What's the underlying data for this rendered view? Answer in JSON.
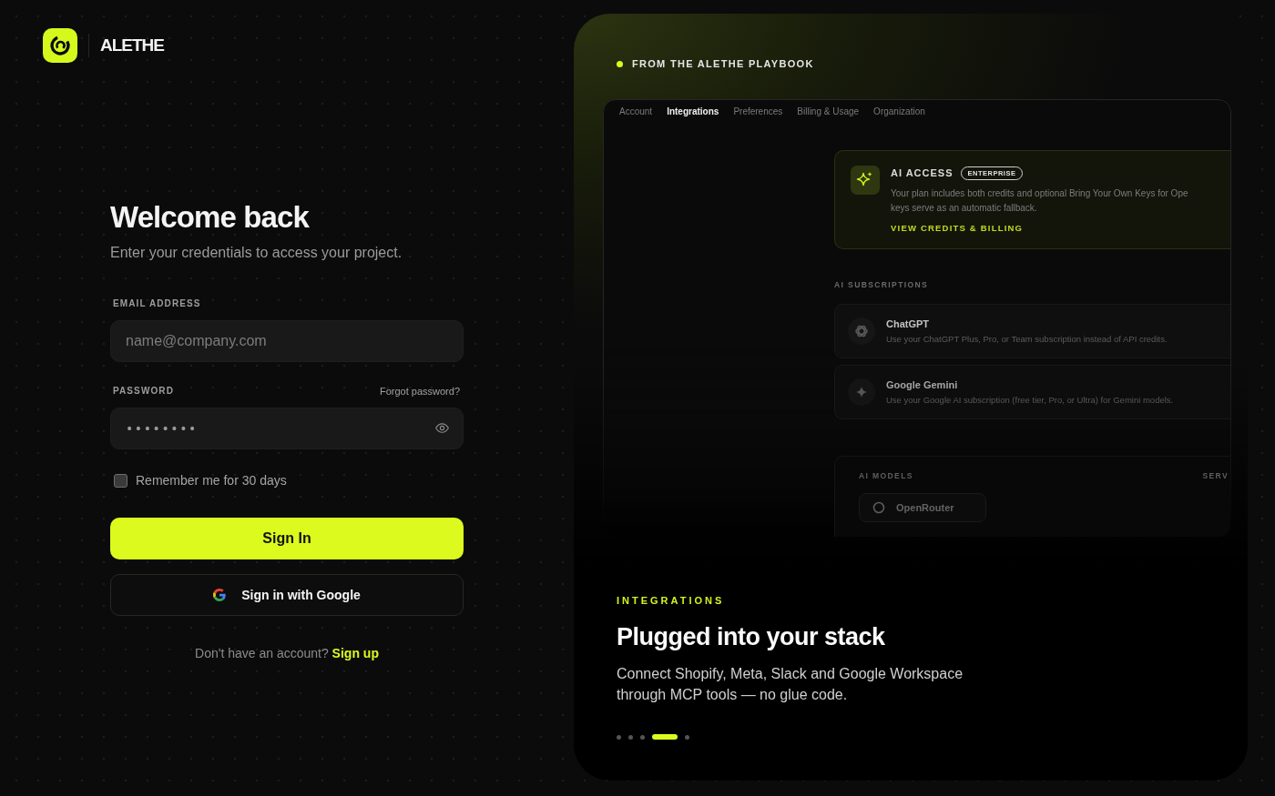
{
  "brand": {
    "name": "ALETHE"
  },
  "login": {
    "title": "Welcome back",
    "subtitle": "Enter your credentials to access your project.",
    "email": {
      "label": "EMAIL ADDRESS",
      "placeholder": "name@company.com"
    },
    "password": {
      "label": "PASSWORD",
      "link": "Forgot password?",
      "value": "••••••••"
    },
    "remember": {
      "label": "Remember me for 30 days",
      "checked": false
    },
    "sign_in_button": "Sign In",
    "google_button": "Sign in with Google",
    "signup": {
      "text": "Don't have an account?",
      "link": "Sign up"
    }
  },
  "showcase": {
    "eyebrow": "FROM THE ALETHE PLAYBOOK",
    "preview": {
      "tabs": [
        {
          "label": "Account",
          "selected": false
        },
        {
          "label": "Integrations",
          "selected": true
        },
        {
          "label": "Preferences",
          "selected": false
        },
        {
          "label": "Billing & Usage",
          "selected": false
        },
        {
          "label": "Organization",
          "selected": false
        }
      ],
      "ai_access": {
        "title": "AI ACCESS",
        "badge": "ENTERPRISE",
        "lines": [
          "Your plan includes both credits and optional Bring Your Own Keys for Ope",
          "keys serve as an automatic fallback."
        ],
        "link": "VIEW CREDITS & BILLING"
      },
      "subscriptions": {
        "heading": "AI SUBSCRIPTIONS",
        "items": [
          {
            "name": "ChatGPT",
            "description": "Use your ChatGPT Plus, Pro, or Team subscription instead of API credits."
          },
          {
            "name": "Google Gemini",
            "description": "Use your Google AI subscription (free tier, Pro, or Ultra) for Gemini models."
          }
        ]
      },
      "models": {
        "heading": "AI MODELS",
        "column_2": "SERV",
        "items": [
          {
            "name": "OpenRouter"
          }
        ]
      }
    },
    "category": "INTEGRATIONS",
    "title": "Plugged into your stack",
    "description": "Connect Shopify, Meta, Slack and Google Workspace through MCP tools — no glue code.",
    "slides": [
      {
        "selected": false
      },
      {
        "selected": false
      },
      {
        "selected": false
      },
      {
        "selected": true
      },
      {
        "selected": false
      }
    ]
  }
}
